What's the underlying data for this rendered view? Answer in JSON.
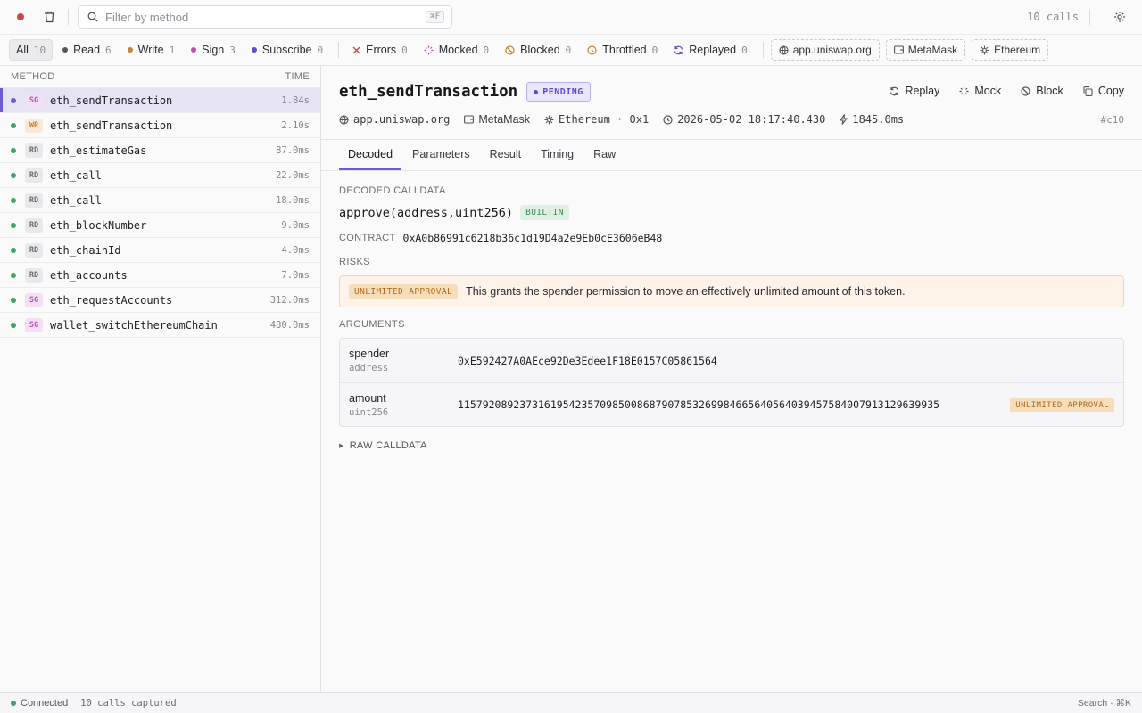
{
  "toolbar": {
    "search_placeholder": "Filter by method",
    "search_shortcut": "⌘F",
    "call_count": "10 calls"
  },
  "filters": [
    {
      "label": "All",
      "count": "10",
      "active": true,
      "kind": "none"
    },
    {
      "label": "Read",
      "count": "6",
      "kind": "dot",
      "color": "#555555"
    },
    {
      "label": "Write",
      "count": "1",
      "kind": "dot",
      "color": "#c08440"
    },
    {
      "label": "Sign",
      "count": "3",
      "kind": "dot",
      "color": "#b452b9"
    },
    {
      "label": "Subscribe",
      "count": "0",
      "kind": "dot",
      "color": "#5e4ccf"
    },
    {
      "label": "Errors",
      "count": "0",
      "kind": "icon",
      "icon": "x-icon",
      "color": "#c94a4a"
    },
    {
      "label": "Mocked",
      "count": "0",
      "kind": "icon",
      "icon": "loader-icon",
      "color": "#b452b9"
    },
    {
      "label": "Blocked",
      "count": "0",
      "kind": "icon",
      "icon": "block-icon",
      "color": "#c88434"
    },
    {
      "label": "Throttled",
      "count": "0",
      "kind": "icon",
      "icon": "clock-icon",
      "color": "#c88434"
    },
    {
      "label": "Replayed",
      "count": "0",
      "kind": "icon",
      "icon": "refresh-icon",
      "color": "#5e4ccf"
    }
  ],
  "context": {
    "origin": "app.uniswap.org",
    "wallet": "MetaMask",
    "network": "Ethereum"
  },
  "list": {
    "col_method": "METHOD",
    "col_time": "TIME",
    "rows": [
      {
        "badge": "SG",
        "method": "eth_sendTransaction",
        "time": "1.84s",
        "dot": "#6e5ad6",
        "selected": true
      },
      {
        "badge": "WR",
        "method": "eth_sendTransaction",
        "time": "2.10s",
        "dot": "#3aa769"
      },
      {
        "badge": "RD",
        "method": "eth_estimateGas",
        "time": "87.0ms",
        "dot": "#3aa769"
      },
      {
        "badge": "RD",
        "method": "eth_call",
        "time": "22.0ms",
        "dot": "#3aa769"
      },
      {
        "badge": "RD",
        "method": "eth_call",
        "time": "18.0ms",
        "dot": "#3aa769"
      },
      {
        "badge": "RD",
        "method": "eth_blockNumber",
        "time": "9.0ms",
        "dot": "#3aa769"
      },
      {
        "badge": "RD",
        "method": "eth_chainId",
        "time": "4.0ms",
        "dot": "#3aa769"
      },
      {
        "badge": "RD",
        "method": "eth_accounts",
        "time": "7.0ms",
        "dot": "#3aa769"
      },
      {
        "badge": "SG",
        "method": "eth_requestAccounts",
        "time": "312.0ms",
        "dot": "#3aa769"
      },
      {
        "badge": "SG",
        "method": "wallet_switchEthereumChain",
        "time": "480.0ms",
        "dot": "#3aa769"
      }
    ]
  },
  "detail": {
    "title": "eth_sendTransaction",
    "status": "PENDING",
    "actions": {
      "replay": "Replay",
      "mock": "Mock",
      "block": "Block",
      "copy": "Copy"
    },
    "meta": {
      "origin": "app.uniswap.org",
      "wallet": "MetaMask",
      "network": "Ethereum · 0x1",
      "timestamp": "2026-05-02 18:17:40.430",
      "duration": "1845.0ms",
      "id": "#c10"
    },
    "tabs": [
      "Decoded",
      "Parameters",
      "Result",
      "Timing",
      "Raw"
    ],
    "active_tab": "Decoded",
    "decoded": {
      "section_title": "DECODED CALLDATA",
      "signature": "approve(address,uint256)",
      "sig_tag": "BUILTIN",
      "contract_label": "CONTRACT",
      "contract_address": "0xA0b86991c6218b36c1d19D4a2e9Eb0cE3606eB48",
      "risks_title": "RISKS",
      "risk_tag": "UNLIMITED APPROVAL",
      "risk_text": "This grants the spender permission to move an effectively unlimited amount of this token.",
      "args_title": "ARGUMENTS",
      "args": [
        {
          "name": "spender",
          "type": "address",
          "value": "0xE592427A0AEce92De3Edee1F18E0157C05861564",
          "tag": ""
        },
        {
          "name": "amount",
          "type": "uint256",
          "value": "115792089237316195423570985008687907853269984665640564039457584007913129639935",
          "tag": "UNLIMITED APPROVAL"
        }
      ],
      "raw_label": "RAW CALLDATA"
    }
  },
  "status_bar": {
    "connection": "Connected",
    "captured": "10 calls captured",
    "hint": "Search · ⌘K"
  }
}
